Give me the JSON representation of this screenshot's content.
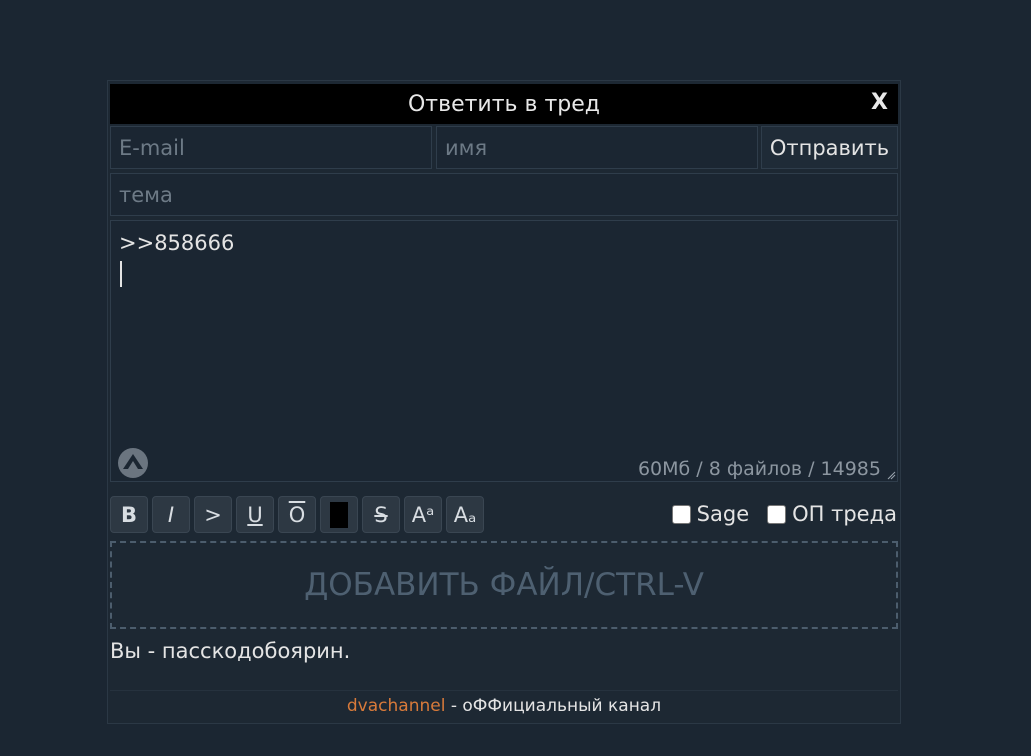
{
  "dialog": {
    "title": "Ответить в тред",
    "close_label": "X"
  },
  "form": {
    "email_placeholder": "E-mail",
    "name_placeholder": "имя",
    "send_label": "Отправить",
    "subject_placeholder": "тема",
    "message_text": ">>858666",
    "limits_text": "60Мб / 8 файлов / 14985"
  },
  "toolbar": {
    "bold": "B",
    "italic": "I",
    "quote": ">",
    "underline": "U",
    "overline": "O",
    "strike": "S",
    "sup": "Aᵃ",
    "sub": "Aₐ"
  },
  "options": {
    "sage_label": "Sage",
    "op_label": "ОП треда"
  },
  "dropzone": {
    "label": "ДОБАВИТЬ ФАЙЛ/CTRL-V"
  },
  "pass_note": "Вы - пасскодобоярин.",
  "footer": {
    "channel_link": "dvachannel",
    "channel_suffix": " - оФФициальный канал"
  },
  "colors": {
    "background": "#1b2632",
    "titlebar": "#000000",
    "link": "#d87a3a"
  }
}
